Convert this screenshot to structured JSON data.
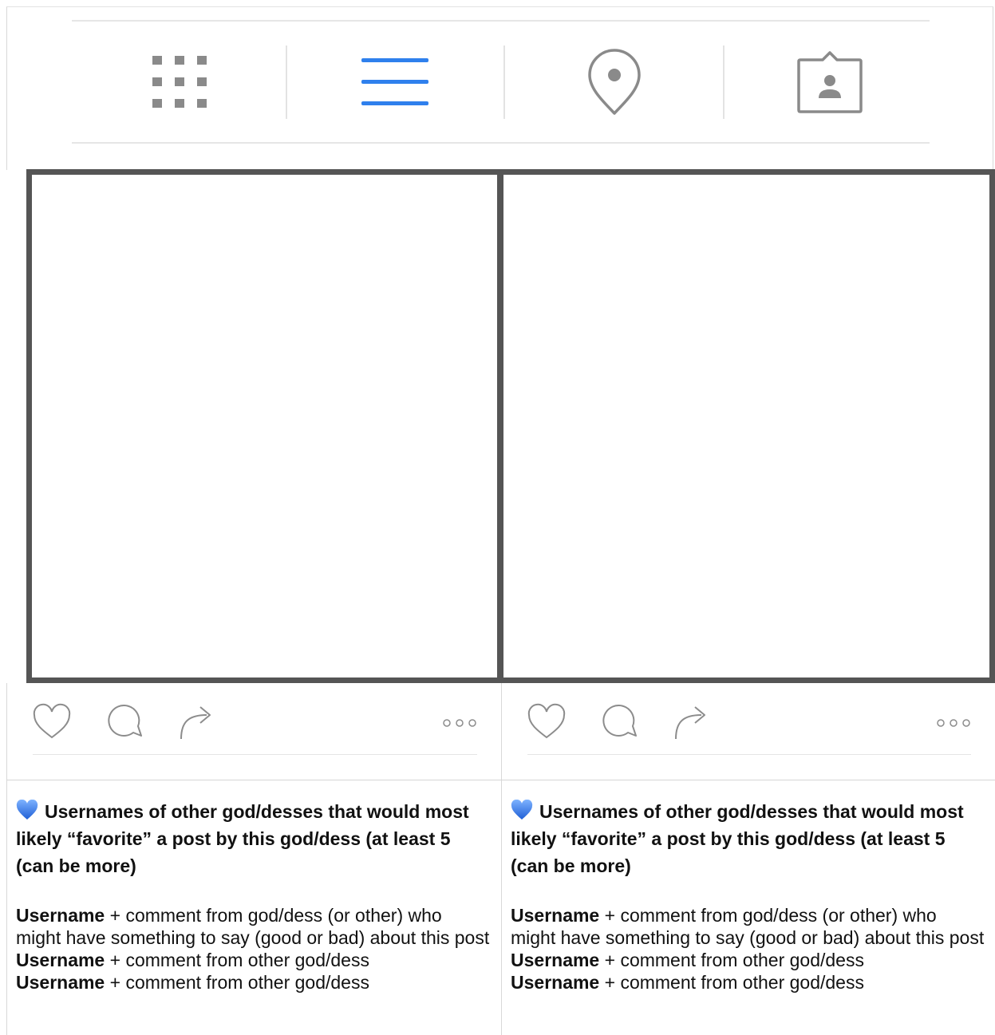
{
  "tabs": [
    {
      "name": "grid-view",
      "icon": "grid-icon",
      "active": false
    },
    {
      "name": "list-view",
      "icon": "list-icon",
      "active": true
    },
    {
      "name": "places",
      "icon": "map-pin-icon",
      "active": false
    },
    {
      "name": "tagged",
      "icon": "tagged-person-icon",
      "active": false
    }
  ],
  "colors": {
    "active_tab": "#2f80ed",
    "inactive_icon": "#8a8a8a",
    "frame_border": "#555555",
    "heart_emoji": "#3b7de8"
  },
  "posts": [
    {
      "caption_title": "Usernames of other god/desses that would most likely “favorite” a post by this god/dess (at least 5 (can be more)",
      "comments": [
        {
          "username": "Username",
          "text": " + comment from god/dess (or other) who might have something to say (good or bad) about this post"
        },
        {
          "username": "Username",
          "text": " + comment from other god/dess"
        },
        {
          "username": "Username",
          "text": " + comment from other god/dess"
        }
      ]
    },
    {
      "caption_title": "Usernames of other god/desses that would most likely “favorite” a post by this god/dess (at least 5 (can be more)",
      "comments": [
        {
          "username": "Username",
          "text": " + comment from god/dess (or other) who might have something to say (good or bad) about this post"
        },
        {
          "username": "Username",
          "text": " + comment from other god/dess"
        },
        {
          "username": "Username",
          "text": " + comment from other god/dess"
        }
      ]
    }
  ]
}
